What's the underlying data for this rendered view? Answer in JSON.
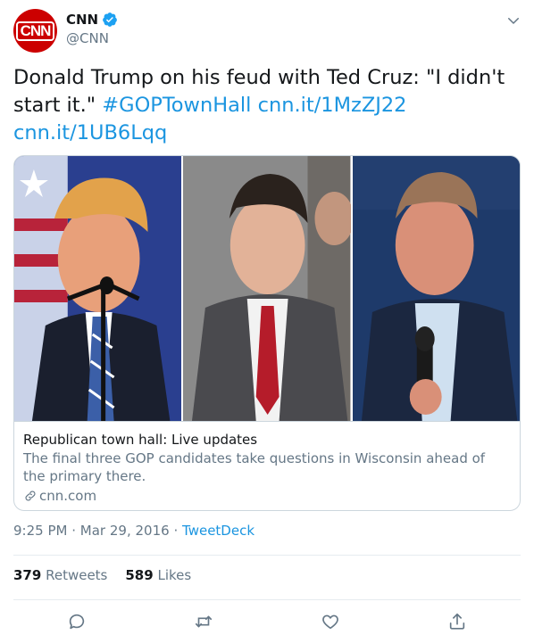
{
  "author": {
    "display_name": "CNN",
    "handle": "@CNN",
    "avatar_text": "CNN",
    "verified": true
  },
  "tweet": {
    "text_plain": "Donald Trump on his feud with Ted Cruz: \"I didn't start it.\"",
    "hashtag": "#GOPTownHall",
    "link1": "cnn.it/1MzZJ22",
    "link2": "cnn.it/1UB6Lqq"
  },
  "card": {
    "title": "Republican town hall: Live updates",
    "description": "The final three GOP candidates take questions in Wisconsin ahead of the primary there.",
    "domain": "cnn.com"
  },
  "meta": {
    "time": "9:25 PM",
    "separator": "·",
    "date": "Mar 29, 2016",
    "source": "TweetDeck"
  },
  "stats": {
    "retweets_count": "379",
    "retweets_label": "Retweets",
    "likes_count": "589",
    "likes_label": "Likes"
  },
  "colors": {
    "brand": "#cc0000",
    "link": "#1b95e0",
    "secondary_text": "#657786",
    "border": "#ccd6dd"
  },
  "icons": [
    "verified-badge-icon",
    "caret-down-icon",
    "link-icon",
    "reply-icon",
    "retweet-icon",
    "like-icon",
    "share-icon"
  ]
}
